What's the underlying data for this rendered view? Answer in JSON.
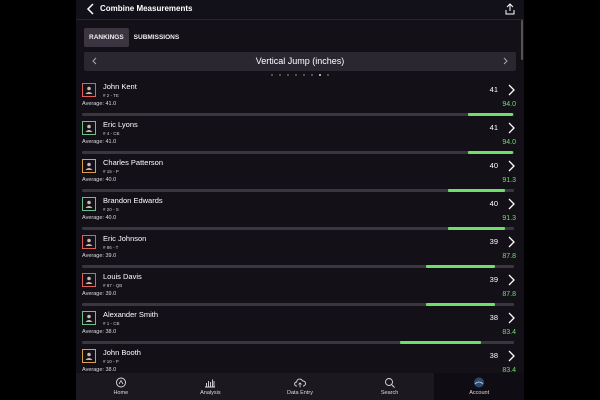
{
  "header": {
    "title": "Combine Measurements"
  },
  "tabs": [
    {
      "label": "RANKINGS",
      "active": true
    },
    {
      "label": "SUBMISSIONS",
      "active": false
    }
  ],
  "metric": {
    "title": "Vertical Jump (inches)",
    "page_count": 8,
    "active_page": 6
  },
  "rows": [
    {
      "name": "John Kent",
      "info": "# 2 - TE",
      "average": "Average: 41.0",
      "score": "41",
      "percent": "94.0",
      "fill_start": 0.893,
      "fill_end": 0.997,
      "color": "#e0605a"
    },
    {
      "name": "Eric Lyons",
      "info": "# 4 - CB",
      "average": "Average: 41.0",
      "score": "41",
      "percent": "94.0",
      "fill_start": 0.893,
      "fill_end": 0.997,
      "color": "#6ec08a"
    },
    {
      "name": "Charles Patterson",
      "info": "# 15 - P",
      "average": "Average: 40.0",
      "score": "40",
      "percent": "91.3",
      "fill_start": 0.847,
      "fill_end": 0.98,
      "color": "#d9a04a"
    },
    {
      "name": "Brandon Edwards",
      "info": "# 20 - S",
      "average": "Average: 40.0",
      "score": "40",
      "percent": "91.3",
      "fill_start": 0.847,
      "fill_end": 0.98,
      "color": "#6ec08a"
    },
    {
      "name": "Eric Johnson",
      "info": "# 86 - T",
      "average": "Average: 39.0",
      "score": "39",
      "percent": "87.8",
      "fill_start": 0.796,
      "fill_end": 0.956,
      "color": "#e0605a"
    },
    {
      "name": "Louis Davis",
      "info": "# 87 - QB",
      "average": "Average: 39.0",
      "score": "39",
      "percent": "87.8",
      "fill_start": 0.796,
      "fill_end": 0.956,
      "color": "#e0605a"
    },
    {
      "name": "Alexander Smith",
      "info": "# 1 - CB",
      "average": "Average: 38.0",
      "score": "38",
      "percent": "83.4",
      "fill_start": 0.736,
      "fill_end": 0.924,
      "color": "#6ec08a"
    },
    {
      "name": "John Booth",
      "info": "# 10 - P",
      "average": "Average: 38.0",
      "score": "38",
      "percent": "83.4",
      "fill_start": 0.736,
      "fill_end": 0.924,
      "color": "#d9a04a"
    }
  ],
  "bottom_nav": [
    {
      "label": "Home",
      "icon": "home-icon",
      "active": false
    },
    {
      "label": "Analysis",
      "icon": "analysis-icon",
      "active": false
    },
    {
      "label": "Data Entry",
      "icon": "cloud-upload-icon",
      "active": false
    },
    {
      "label": "Search",
      "icon": "search-icon",
      "active": false
    },
    {
      "label": "Account",
      "icon": "account-icon",
      "active": true
    }
  ],
  "colors": {
    "accent_green": "#6ee06a",
    "background": "#131018"
  }
}
